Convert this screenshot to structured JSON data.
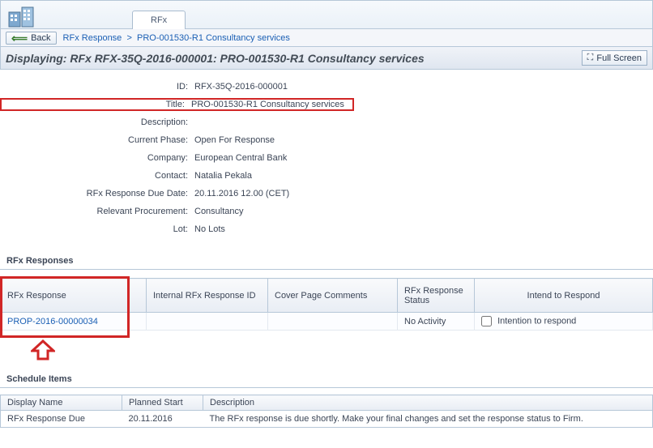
{
  "tab_label": "RFx",
  "back_label": "Back",
  "breadcrumb": {
    "item1": "RFx Response",
    "sep": ">",
    "item2": "PRO-001530-R1 Consultancy services"
  },
  "heading": "Displaying: RFx RFX-35Q-2016-000001: PRO-001530-R1 Consultancy services",
  "fullscreen_label": "Full Screen",
  "details": {
    "id_label": "ID:",
    "id": "RFX-35Q-2016-000001",
    "title_label": "Title:",
    "title": "PRO-001530-R1 Consultancy services",
    "desc_label": "Description:",
    "desc": "",
    "phase_label": "Current Phase:",
    "phase": "Open For Response",
    "company_label": "Company:",
    "company": "European Central Bank",
    "contact_label": "Contact:",
    "contact": "Natalia Pekala",
    "due_label": "RFx Response Due Date:",
    "due": "20.11.2016 12.00 (CET)",
    "proc_label": "Relevant Procurement:",
    "proc": "Consultancy",
    "lot_label": "Lot:",
    "lot": "No Lots"
  },
  "responses_title": "RFx Responses",
  "responses_headers": {
    "c1": "RFx Response",
    "c2": "Internal RFx Response ID",
    "c3": "Cover Page Comments",
    "c4": "RFx Response Status",
    "c5": "Intend to Respond"
  },
  "responses_row": {
    "id": "PROP-2016-00000034",
    "internal": "",
    "cover": "",
    "status": "No Activity",
    "intend_label": "Intention to respond"
  },
  "schedule_title": "Schedule Items",
  "schedule_headers": {
    "c1": "Display Name",
    "c2": "Planned Start",
    "c3": "Description"
  },
  "schedule_row": {
    "name": "RFx Response Due",
    "date": "20.11.2016",
    "desc": "The RFx response is due shortly. Make your final changes and set the response status to Firm."
  }
}
